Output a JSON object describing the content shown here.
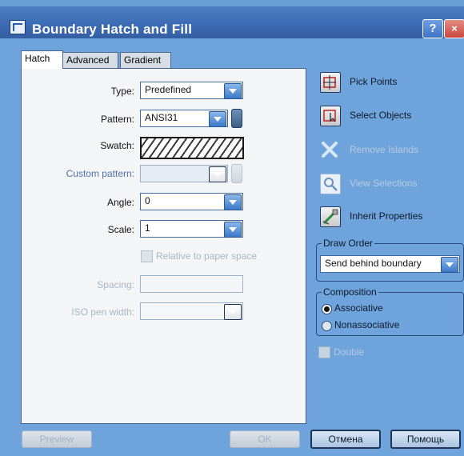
{
  "window": {
    "title": "Boundary Hatch and Fill",
    "help_glyph": "?",
    "close_glyph": "×"
  },
  "tabs": [
    {
      "label": "Hatch",
      "active": true
    },
    {
      "label": "Advanced",
      "active": false
    },
    {
      "label": "Gradient",
      "active": false
    }
  ],
  "hatch": {
    "type_label": "Type:",
    "type_value": "Predefined",
    "pattern_label": "Pattern:",
    "pattern_value": "ANSI31",
    "swatch_label": "Swatch:",
    "custom_pattern_label": "Custom pattern:",
    "custom_pattern_value": "",
    "angle_label": "Angle:",
    "angle_value": "0",
    "scale_label": "Scale:",
    "scale_value": "1",
    "relative_label": "Relative to paper space",
    "spacing_label": "Spacing:",
    "spacing_value": "",
    "iso_pen_label": "ISO pen width:",
    "iso_pen_value": ""
  },
  "actions": {
    "pick_points": "Pick Points",
    "select_objects": "Select Objects",
    "remove_islands": "Remove Islands",
    "view_selections": "View Selections",
    "inherit_properties": "Inherit Properties"
  },
  "draw_order": {
    "title": "Draw Order",
    "value": "Send behind boundary"
  },
  "composition": {
    "title": "Composition",
    "associative": "Associative",
    "nonassociative": "Nonassociative",
    "selected": "Associative"
  },
  "double_label": "Double",
  "buttons": {
    "preview": "Preview",
    "ok": "OK",
    "cancel": "Отмена",
    "help": "Помощь"
  },
  "colors": {
    "title_bar": "#3a6ab3",
    "dialog_bg": "#6ea3db",
    "panel_bg": "#f4f5f6"
  }
}
